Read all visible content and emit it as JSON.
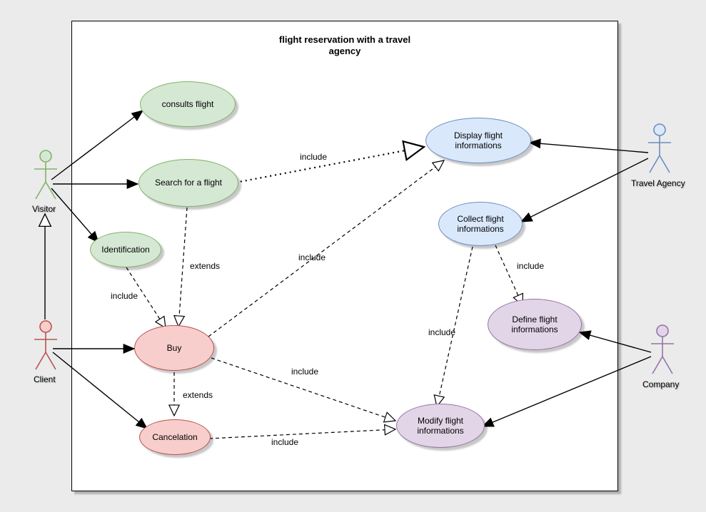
{
  "title_line1": "flight reservation with a travel",
  "title_line2": "agency",
  "actors": {
    "visitor": "Visitor",
    "client": "Client",
    "travel_agency": "Travel Agency",
    "company": "Company"
  },
  "usecases": {
    "consults_flight": "consults flight",
    "search_flight": "Search for a flight",
    "identification": "Identification",
    "buy": "Buy",
    "cancelation": "Cancelation",
    "display_info": "Display flight\ninformations",
    "collect_info": "Collect flight\ninformations",
    "define_info": "Define flight\ninformations",
    "modify_info": "Modify flight\ninformations"
  },
  "labels": {
    "include": "include",
    "extends": "extends"
  },
  "colors": {
    "green_fill": "#d5e8d4",
    "green_stroke": "#82b366",
    "pink_fill": "#f8cecc",
    "pink_stroke": "#b85450",
    "blue_fill": "#dae8fc",
    "blue_stroke": "#6c8ebf",
    "purple_fill": "#e1d5e7",
    "purple_stroke": "#9673a6"
  }
}
